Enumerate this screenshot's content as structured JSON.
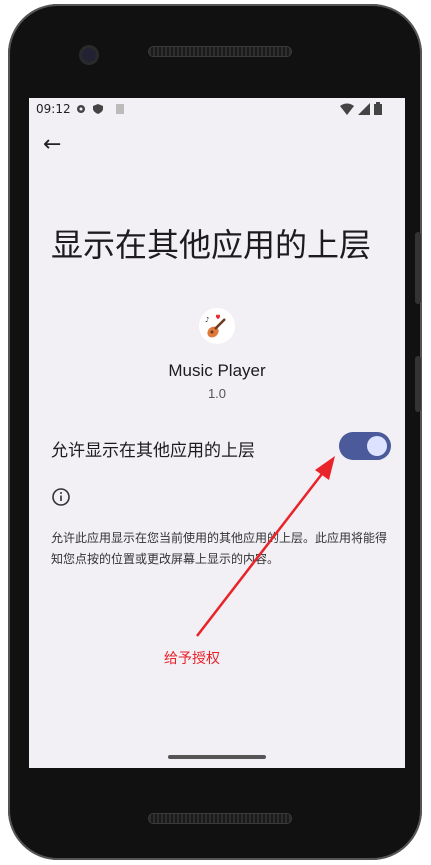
{
  "status_bar": {
    "time": "09:12"
  },
  "toolbar": {
    "back_label": "←"
  },
  "page": {
    "title": "显示在其他应用的上层"
  },
  "app": {
    "name": "Music Player",
    "version": "1.0"
  },
  "permission": {
    "toggle_label": "允许显示在其他应用的上层",
    "toggle_on": true,
    "description": "允许此应用显示在您当前使用的其他应用的上层。此应用将能得知您点按的位置或更改屏幕上显示的内容。"
  },
  "annotation": {
    "text": "给予授权",
    "color": "#e8232a"
  },
  "colors": {
    "toggle_track": "#4a5a9a",
    "screen_bg": "#f2eff5",
    "annotation": "#e8232a"
  }
}
